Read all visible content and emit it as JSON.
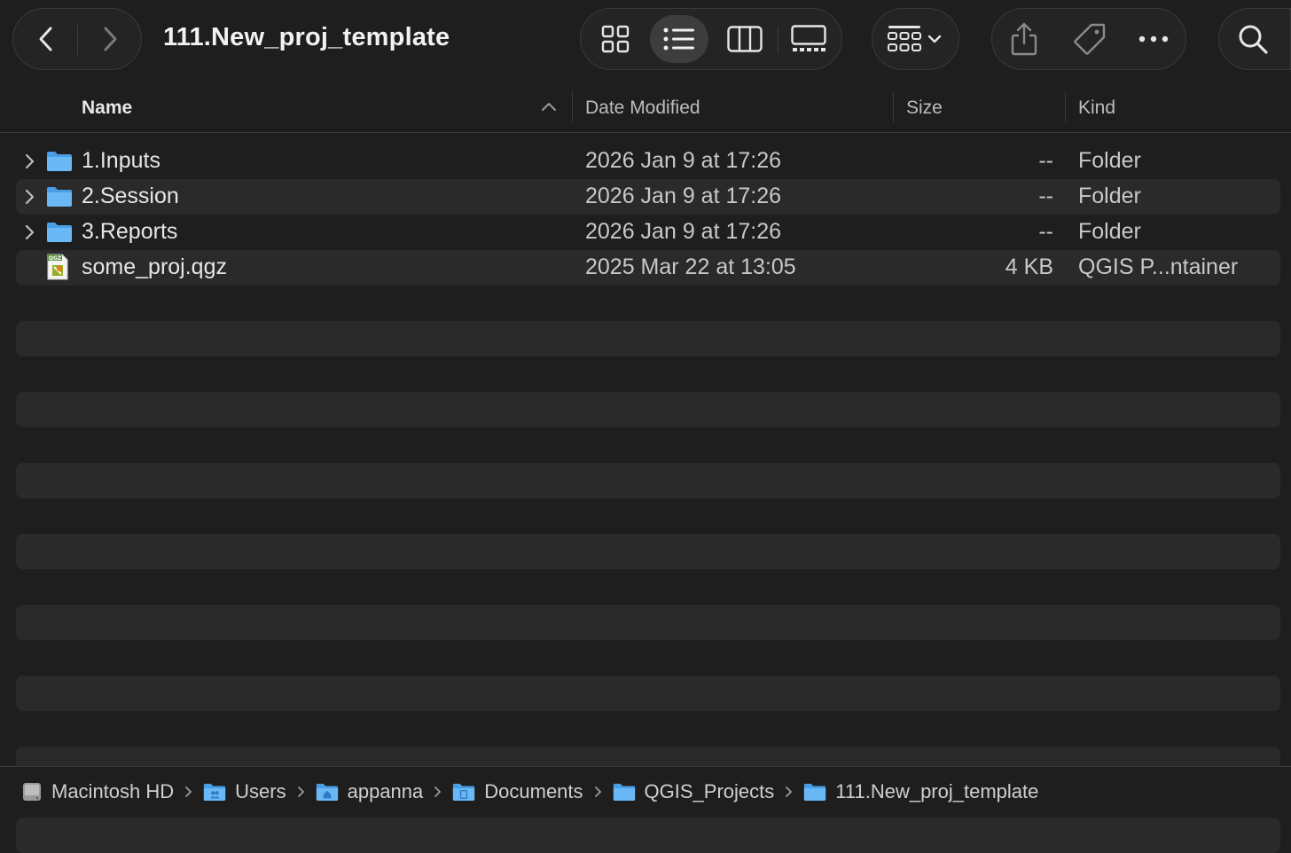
{
  "window": {
    "title": "111.New_proj_template"
  },
  "columns": {
    "name": "Name",
    "date": "Date Modified",
    "size": "Size",
    "kind": "Kind"
  },
  "files": [
    {
      "name": "1.Inputs",
      "date": "2026 Jan 9 at 17:26",
      "size": "--",
      "kind": "Folder",
      "icon": "folder-icon"
    },
    {
      "name": "2.Session",
      "date": "2026 Jan 9 at 17:26",
      "size": "--",
      "kind": "Folder",
      "icon": "folder-icon"
    },
    {
      "name": "3.Reports",
      "date": "2026 Jan 9 at 17:26",
      "size": "--",
      "kind": "Folder",
      "icon": "folder-icon"
    },
    {
      "name": "some_proj.qgz",
      "date": "2025 Mar 22 at 13:05",
      "size": "4 KB",
      "kind": "QGIS P...ntainer",
      "icon": "qgz-file-icon",
      "icon_label": "QGZ"
    }
  ],
  "path": [
    {
      "label": "Macintosh HD",
      "icon": "hard-drive-icon"
    },
    {
      "label": "Users",
      "icon": "users-folder-icon"
    },
    {
      "label": "appanna",
      "icon": "home-folder-icon"
    },
    {
      "label": "Documents",
      "icon": "documents-folder-icon"
    },
    {
      "label": "QGIS_Projects",
      "icon": "folder-icon"
    },
    {
      "label": "111.New_proj_template",
      "icon": "folder-icon"
    }
  ],
  "colors": {
    "background": "#1e1e1e",
    "stripe": "#2a2a2a",
    "folder": "#5aaef2",
    "text": "#e6e6e6"
  }
}
